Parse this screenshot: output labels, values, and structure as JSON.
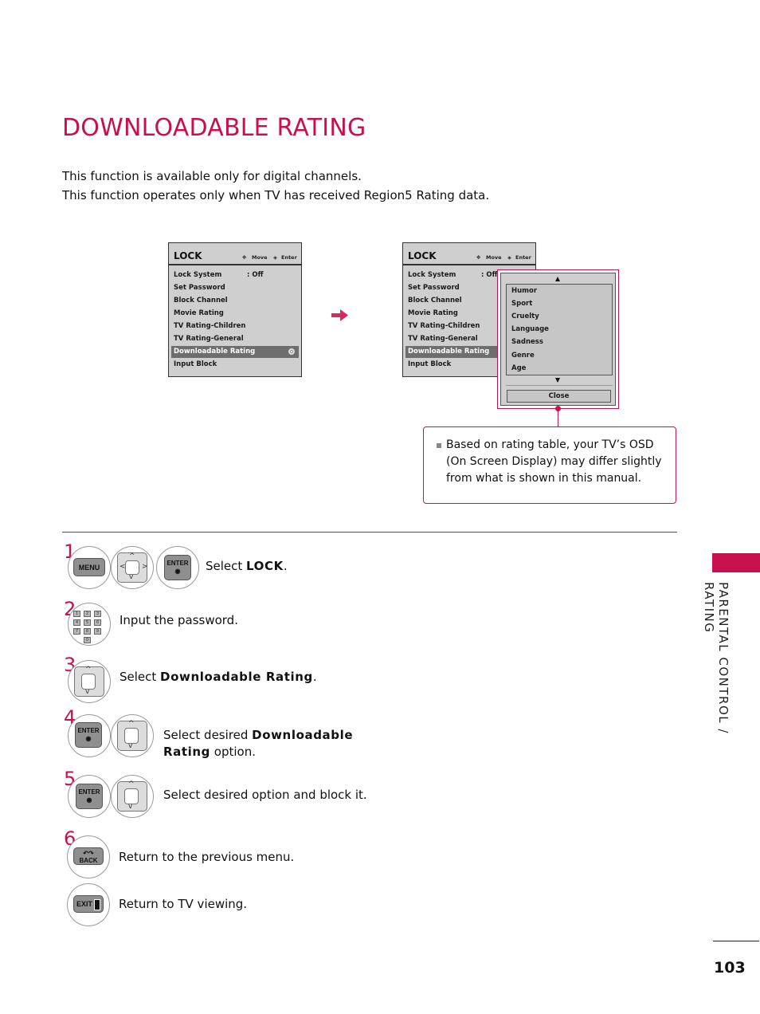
{
  "page": {
    "title": "DOWNLOADABLE RATING",
    "intro": [
      "This function is available only for digital channels.",
      "This function operates only when TV has received Region5 Rating data."
    ],
    "section_label": "PARENTAL CONTROL / RATING",
    "page_number": "103",
    "accent_color": "#c8104e"
  },
  "osd_left": {
    "title": "LOCK",
    "hint_move": "Move",
    "hint_enter": "Enter",
    "items": [
      {
        "label": "Lock System",
        "value": ": Off"
      },
      {
        "label": "Set Password"
      },
      {
        "label": "Block Channel"
      },
      {
        "label": "Movie Rating"
      },
      {
        "label": "TV Rating-Children"
      },
      {
        "label": "TV Rating-General"
      },
      {
        "label": "Downloadable Rating",
        "selected": true
      },
      {
        "label": "Input Block"
      }
    ]
  },
  "osd_right": {
    "title": "LOCK",
    "hint_move": "Move",
    "hint_enter": "Enter",
    "items": [
      {
        "label": "Lock System",
        "value": ": Off"
      },
      {
        "label": "Set Password"
      },
      {
        "label": "Block Channel"
      },
      {
        "label": "Movie Rating"
      },
      {
        "label": "TV Rating-Children"
      },
      {
        "label": "TV Rating-General"
      },
      {
        "label": "Downloadable Rating",
        "selected": true
      },
      {
        "label": "Input Block"
      }
    ],
    "popup": {
      "options": [
        "Humor",
        "Sport",
        "Cruelty",
        "Language",
        "Sadness",
        "Genre",
        "Age"
      ],
      "close_label": "Close"
    }
  },
  "note": "Based on rating table, your TV’s OSD (On Screen Display) may differ slightly from what is shown in this manual.",
  "steps": [
    {
      "num": "1",
      "text_pre": "Select ",
      "text_bold": "LOCK",
      "text_post": ".",
      "keys": [
        "MENU",
        "dpad",
        "ENTER"
      ]
    },
    {
      "num": "2",
      "text_pre": "Input the password.",
      "keys": [
        "numpad"
      ]
    },
    {
      "num": "3",
      "text_pre": "Select ",
      "text_bold": "Downloadable Rating",
      "text_post": ".",
      "keys": [
        "dpad-vertical"
      ]
    },
    {
      "num": "4",
      "text_pre": "Select desired ",
      "text_bold": "Downloadable",
      "text_bold2": "Rating",
      "text_post": " option.",
      "keys": [
        "ENTER",
        "dpad-vertical"
      ]
    },
    {
      "num": "5",
      "text_pre": "Select desired option and block it.",
      "keys": [
        "ENTER",
        "dpad-vertical"
      ]
    },
    {
      "num": "6",
      "text_pre": "Return to the previous menu.",
      "keys": [
        "BACK"
      ]
    },
    {
      "num": "",
      "text_pre": "Return to TV viewing.",
      "keys": [
        "EXIT"
      ]
    }
  ],
  "keys": {
    "menu": "MENU",
    "enter": "ENTER",
    "back": "BACK",
    "exit": "EXIT",
    "numpad": [
      "1",
      "2",
      "3",
      "4",
      "5",
      "6",
      "7",
      "8",
      "9",
      "0"
    ]
  }
}
